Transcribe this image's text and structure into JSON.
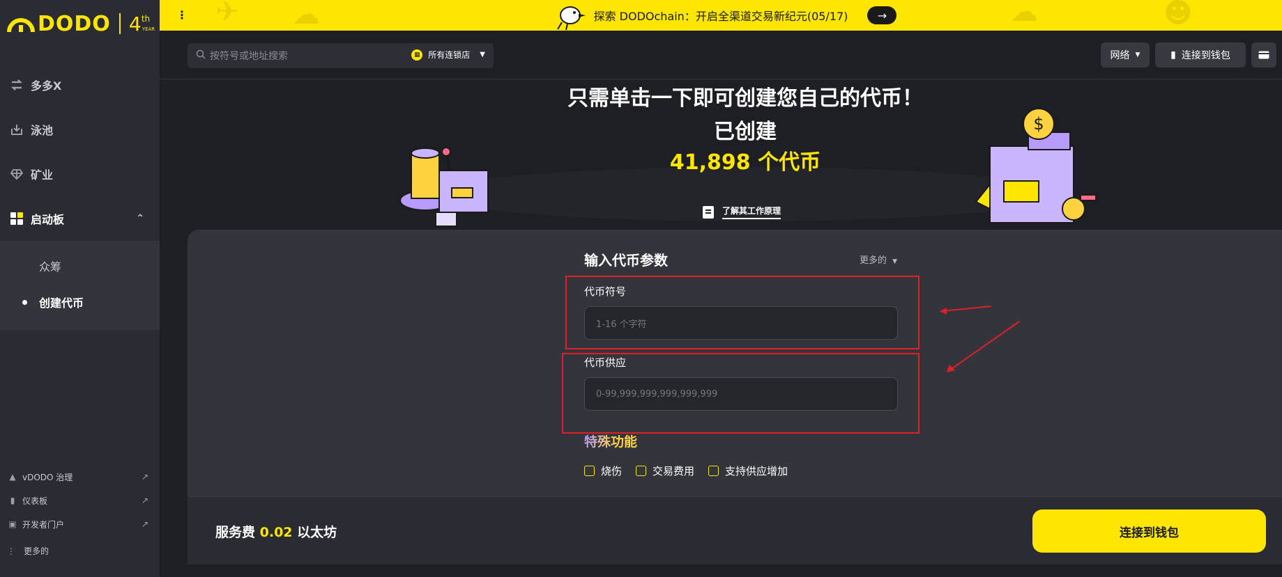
{
  "sidebar": {
    "logo_text": "DODO",
    "logo_anniv": "4",
    "logo_anniv_sup": "th",
    "logo_anniv_sub": "YEAR",
    "items": [
      {
        "label": "多多X",
        "icon": "swap-icon"
      },
      {
        "label": "泳池",
        "icon": "pool-icon"
      },
      {
        "label": "矿业",
        "icon": "diamond-icon"
      },
      {
        "label": "启动板",
        "icon": "grid-icon"
      }
    ],
    "sub_items": [
      {
        "label": "众筹"
      },
      {
        "label": "创建代币"
      }
    ],
    "footer_links": [
      {
        "label": "vDODO 治理",
        "icon": "vdodo-icon"
      },
      {
        "label": "仪表板",
        "icon": "bar-chart-icon"
      },
      {
        "label": "开发者门户",
        "icon": "developer-icon"
      }
    ],
    "more_label": "更多的"
  },
  "banner": {
    "text": "探索 DODOchain：开启全渠道交易新纪元(05/17)",
    "arrow": "→"
  },
  "header": {
    "search_placeholder": "按符号或地址搜索",
    "chain_label": "所有连锁店",
    "network_label": "网络",
    "wallet_label": "连接到钱包"
  },
  "hero": {
    "title": "只需单击一下即可创建您自己的代币！",
    "subtitle": "已创建",
    "count": "41,898 个代币",
    "learn_label": "了解其工作原理"
  },
  "form": {
    "title": "输入代币参数",
    "more_label": "更多的",
    "symbol_label": "代币符号",
    "symbol_placeholder": "1-16 个字符",
    "supply_label": "代币供应",
    "supply_placeholder": "0-99,999,999,999,999,999",
    "special_label": "特殊功能",
    "checks": [
      {
        "label": "烧伤",
        "checked": false
      },
      {
        "label": "交易费用",
        "checked": false
      },
      {
        "label": "支持供应增加",
        "checked": false
      }
    ]
  },
  "footer": {
    "fee_prefix": "服务费",
    "fee_amount": "0.02",
    "fee_unit": "以太坊",
    "connect_label": "连接到钱包"
  },
  "colors": {
    "accent": "#ffe600",
    "background": "#1e1f24",
    "panel": "#34353c",
    "sidebar": "#2b2c33",
    "highlight": "#e01f26"
  }
}
